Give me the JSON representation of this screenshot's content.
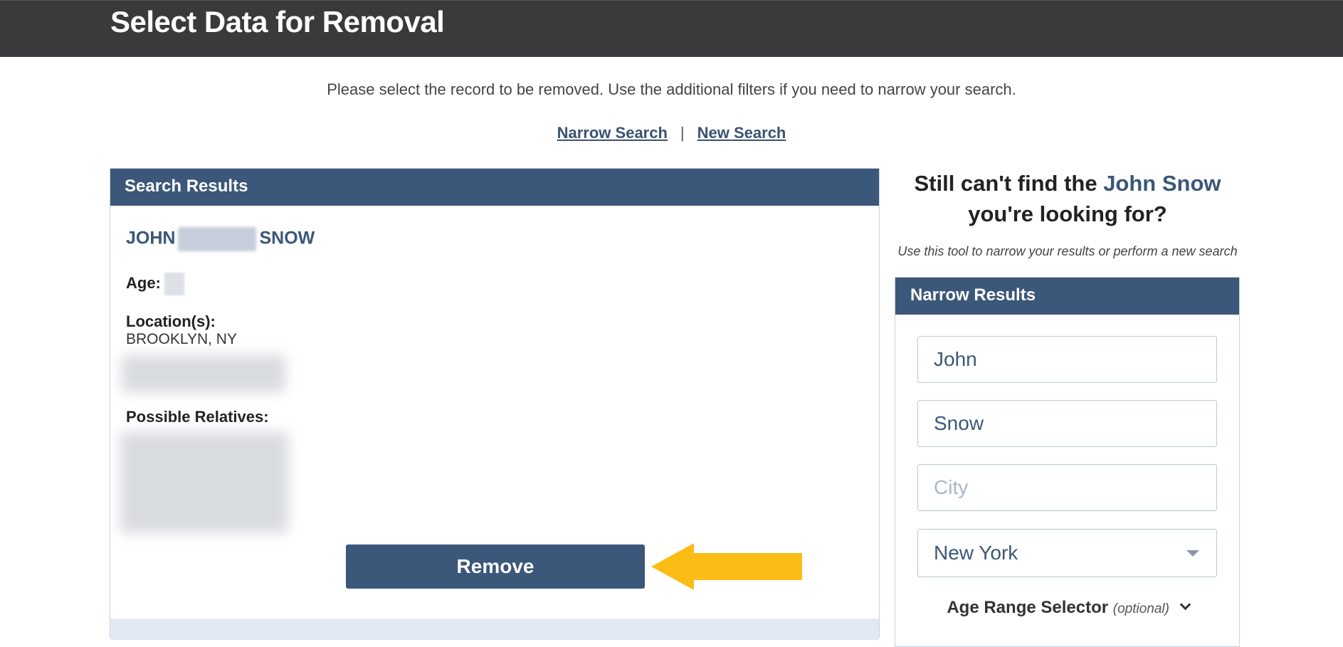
{
  "header": {
    "title": "Select Data for Removal"
  },
  "intro": {
    "text": "Please select the record to be removed. Use the additional filters if you need to narrow your search."
  },
  "links": {
    "narrow": "Narrow Search",
    "separator": "|",
    "new": "New Search"
  },
  "results": {
    "title": "Search Results",
    "first_name": "JOHN",
    "last_name": "SNOW",
    "age_label": "Age:",
    "location_label": "Location(s):",
    "location_value": "BROOKLYN, NY",
    "relatives_label": "Possible Relatives:",
    "remove_label": "Remove"
  },
  "sidebar": {
    "still_prefix": "Still can't find the ",
    "still_name": "John Snow",
    "still_suffix": " you're looking for?",
    "subtitle": "Use this tool to narrow your results or perform a new search",
    "panel_title": "Narrow Results",
    "first_name_value": "John",
    "last_name_value": "Snow",
    "city_placeholder": "City",
    "state_value": "New York",
    "age_range_label": "Age Range Selector",
    "age_range_optional": "(optional)"
  },
  "colors": {
    "brand": "#3b5779",
    "header_bg": "#3a3a3c",
    "arrow": "#fbbc16"
  }
}
